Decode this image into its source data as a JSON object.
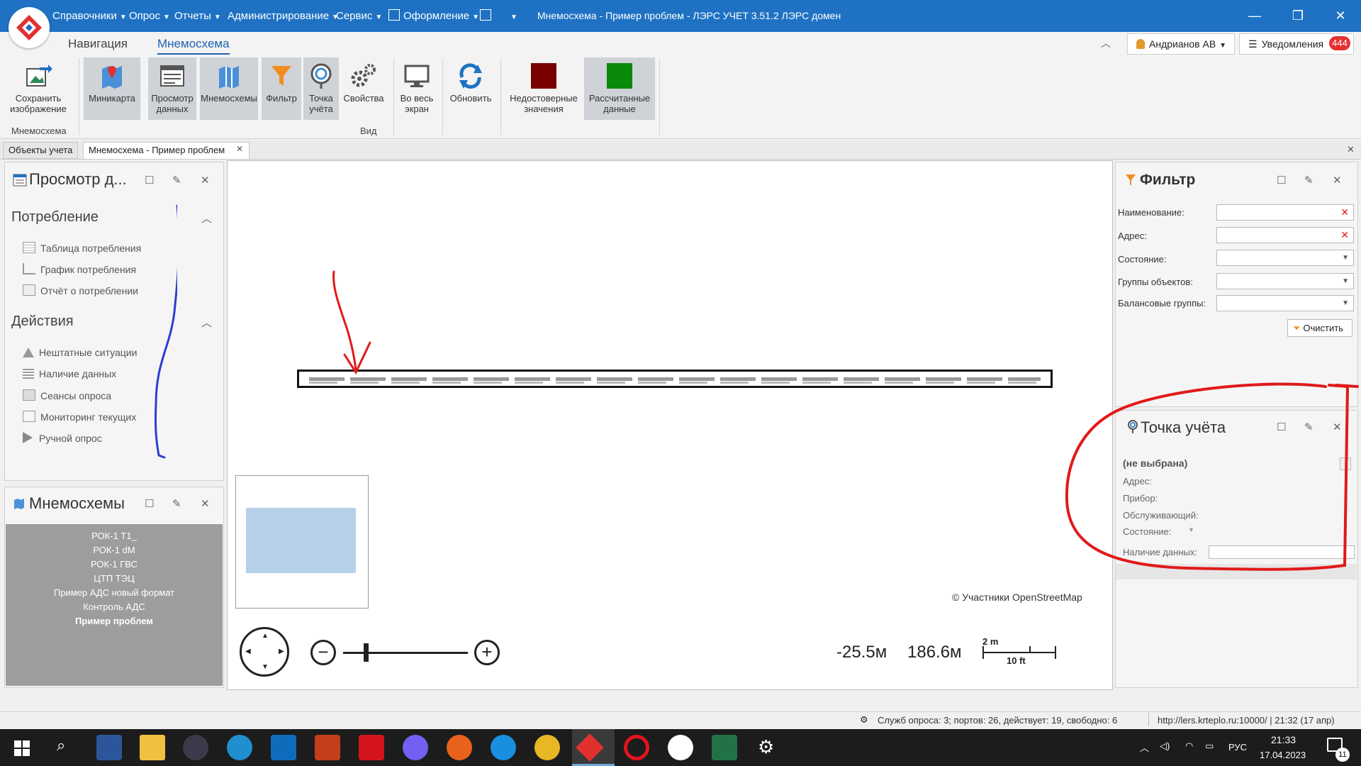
{
  "app": {
    "menu": [
      "Справочники",
      "Опрос",
      "Отчеты",
      "Администрирование",
      "Сервис",
      "Оформление"
    ],
    "window_title": "Мнемосхема - Пример проблем - ЛЭРС УЧЕТ 3.51.2 ЛЭРС домен"
  },
  "ribbon": {
    "tabs": [
      "Навигация",
      "Мнемосхема"
    ],
    "user": "Андрианов АВ",
    "notifications_label": "Уведомления",
    "notifications_count": "444",
    "buttons": {
      "save_image": [
        "Сохранить",
        "изображение"
      ],
      "minimap": [
        "Миникарта"
      ],
      "view_data": [
        "Просмотр",
        "данных"
      ],
      "mnemos": [
        "Мнемосхемы"
      ],
      "filter": [
        "Фильтр"
      ],
      "point": [
        "Точка",
        "учёта"
      ],
      "props": [
        "Свойства"
      ],
      "fullscreen": [
        "Во весь",
        "экран"
      ],
      "refresh": [
        "Обновить"
      ],
      "invalid": [
        "Недостоверные",
        "значения"
      ],
      "calculated": [
        "Рассчитанные",
        "данные"
      ]
    },
    "groups": [
      "Мнемосхема",
      "Вид"
    ],
    "colors": {
      "invalid": "#7a0000",
      "calculated": "#0a8a0a"
    }
  },
  "doc_tabs": [
    "Объекты учета",
    "Мнемосхема - Пример проблем"
  ],
  "left_panel": {
    "title": "Просмотр д...",
    "sections": [
      {
        "title": "Потребление",
        "items": [
          "Таблица потребления",
          "График потребления",
          "Отчёт о потреблении"
        ]
      },
      {
        "title": "Действия",
        "items": [
          "Нештатные ситуации",
          "Наличие данных",
          "Сеансы опроса",
          "Мониторинг текущих",
          "Ручной опрос"
        ]
      }
    ]
  },
  "mnemos_panel": {
    "title": "Мнемосхемы",
    "items": [
      "РОК-1 Т1_",
      "РОК-1 dM",
      "РОК-1 ГВС",
      "ЦТП ТЭЦ",
      "Пример АДС новый формат",
      "Контроль АДС",
      "Пример проблем"
    ]
  },
  "map": {
    "attribution": "© Участники OpenStreetMap",
    "coord_x": "-25.5м",
    "coord_y": "186.6м",
    "scale_metric": "2 m",
    "scale_imperial": "10 ft",
    "zoom_level": 0.18
  },
  "filter_panel": {
    "title": "Фильтр",
    "labels": [
      "Наименование:",
      "Адрес:",
      "Состояние:",
      "Группы объектов:",
      "Балансовые группы:"
    ],
    "clear_button": "Очистить"
  },
  "point_panel": {
    "title": "Точка учёта",
    "selected": "(не выбрана)",
    "labels": [
      "Адрес:",
      "Прибор:",
      "Обслуживающий:",
      "Состояние:",
      "Наличие данных:"
    ]
  },
  "status": {
    "poll": "Служб опроса: 3; портов: 26, действует: 19, свободно: 6",
    "server": "http://lers.krteplo.ru:10000/ | 21:32 (17 апр)"
  },
  "taskbar": {
    "lang": "РУС",
    "time": "21:33",
    "date": "17.04.2023",
    "notif_count": "11"
  }
}
